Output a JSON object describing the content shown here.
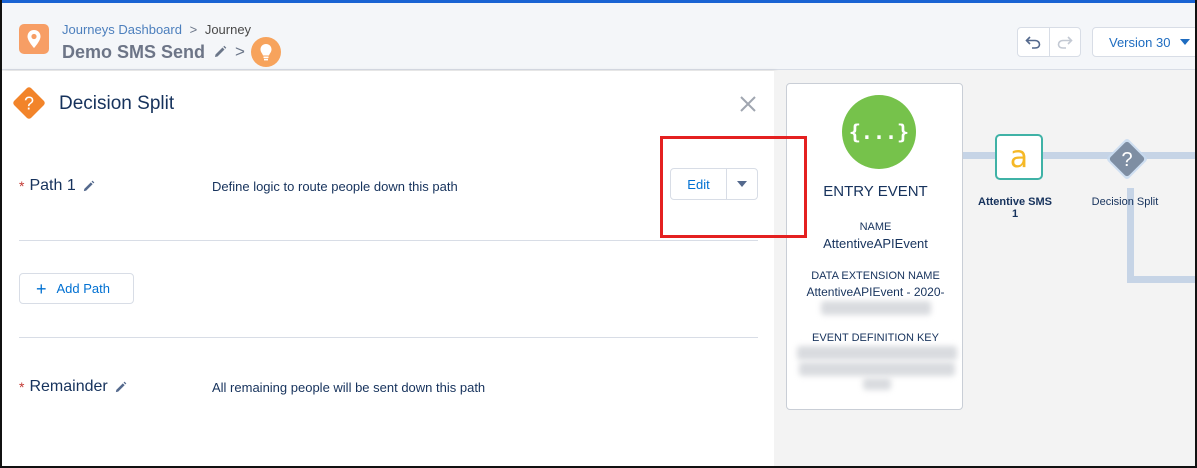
{
  "header": {
    "breadcrumb_link": "Journeys Dashboard",
    "breadcrumb_sep": ">",
    "breadcrumb_current": "Journey",
    "title": "Demo SMS Send",
    "title_chevron": ">",
    "version_label": "Version 30"
  },
  "panel": {
    "title": "Decision Split",
    "paths": [
      {
        "label": "Path 1",
        "required_mark": "*",
        "description": "Define logic to route people down this path"
      }
    ],
    "edit_label": "Edit",
    "add_path_label": "Add Path",
    "add_path_plus": "+",
    "remainder": {
      "label": "Remainder",
      "required_mark": "*",
      "description": "All remaining people will be sent down this path"
    }
  },
  "entry_event": {
    "icon_text": "{...}",
    "title": "ENTRY EVENT",
    "name_label": "NAME",
    "name_value": "AttentiveAPIEvent",
    "de_label": "DATA EXTENSION NAME",
    "de_value": "AttentiveAPIEvent - 2020-",
    "key_label": "EVENT DEFINITION KEY"
  },
  "nodes": {
    "sms_icon_text": "a",
    "sms_label_line1": "Attentive SMS",
    "sms_label_line2": "1",
    "decision_icon_text": "?",
    "decision_label": "Decision Split"
  },
  "colors": {
    "brand_blue": "#0070d2",
    "highlight_red": "#e42020",
    "entry_green": "#76c24b",
    "decision_orange": "#f2842a",
    "sms_teal": "#3fb2a6"
  }
}
